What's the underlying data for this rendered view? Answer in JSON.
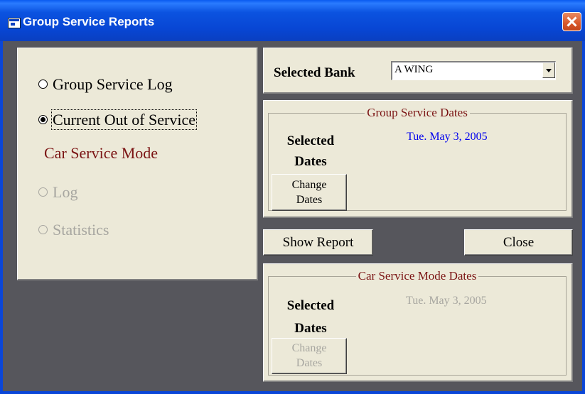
{
  "window": {
    "title": "Group Service Reports"
  },
  "left_panel": {
    "options": [
      {
        "label": "Group Service Log",
        "selected": false,
        "enabled": true
      },
      {
        "label": "Current Out of Service",
        "selected": true,
        "enabled": true
      }
    ],
    "car_service_mode_heading": "Car Service Mode",
    "car_options": [
      {
        "label": "Log",
        "selected": false,
        "enabled": false
      },
      {
        "label": "Statistics",
        "selected": false,
        "enabled": false
      }
    ]
  },
  "bank": {
    "label": "Selected Bank",
    "value": "A WING"
  },
  "group_dates": {
    "title": "Group Service Dates",
    "selected_label_line1": "Selected",
    "selected_label_line2": "Dates",
    "date": "Tue. May 3, 2005",
    "change_line1": "Change",
    "change_line2": "Dates"
  },
  "actions": {
    "show_report": "Show Report",
    "close": "Close"
  },
  "car_dates": {
    "title": "Car Service Mode Dates",
    "selected_label_line1": "Selected",
    "selected_label_line2": "Dates",
    "date": "Tue. May 3, 2005",
    "change_line1": "Change",
    "change_line2": "Dates"
  },
  "colors": {
    "title_bar": "#0a46d8",
    "client_bg": "#56565c",
    "panel_bg": "#ece9d8",
    "heading_red": "#7b1414",
    "date_blue": "#0000ee"
  }
}
